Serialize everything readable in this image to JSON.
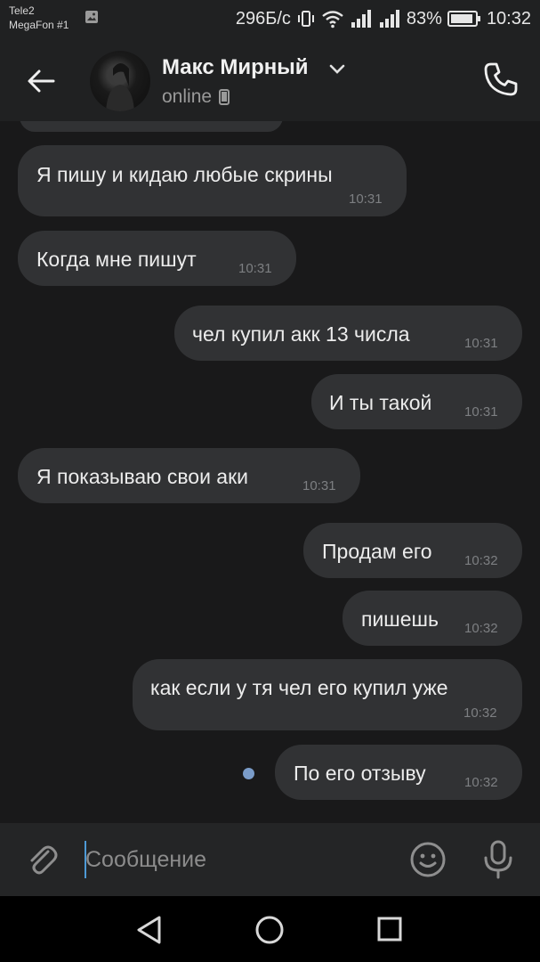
{
  "status_bar": {
    "carrier1": "Tele2",
    "carrier2": "MegaFon #1",
    "network_speed": "296Б/с",
    "battery": "83%",
    "time": "10:32"
  },
  "header": {
    "contact_name": "Макс Мирный",
    "status": "online"
  },
  "messages": [
    {
      "text": "Я пишу и кидаю любые скрины",
      "time": "10:31",
      "side": "in"
    },
    {
      "text": "Когда мне пишут",
      "time": "10:31",
      "side": "in"
    },
    {
      "text": "чел купил акк 13 числа",
      "time": "10:31",
      "side": "out"
    },
    {
      "text": "И ты такой",
      "time": "10:31",
      "side": "out"
    },
    {
      "text": "Я показываю свои аки",
      "time": "10:31",
      "side": "in"
    },
    {
      "text": "Продам его",
      "time": "10:32",
      "side": "out"
    },
    {
      "text": "пишешь",
      "time": "10:32",
      "side": "out"
    },
    {
      "text": "как если у тя чел его купил уже",
      "time": "10:32",
      "side": "out"
    },
    {
      "text": "По его отзыву",
      "time": "10:32",
      "side": "out",
      "unread": true
    }
  ],
  "composer": {
    "placeholder": "Сообщение"
  },
  "colors": {
    "background": "#19191a",
    "bubble": "#313234",
    "unread_dot": "#7a9cc9"
  },
  "icons": [
    "back-arrow-icon",
    "chevron-down-icon",
    "phone-icon",
    "paperclip-icon",
    "emoji-icon",
    "microphone-icon",
    "nav-back-icon",
    "nav-home-icon",
    "nav-recent-icon"
  ]
}
